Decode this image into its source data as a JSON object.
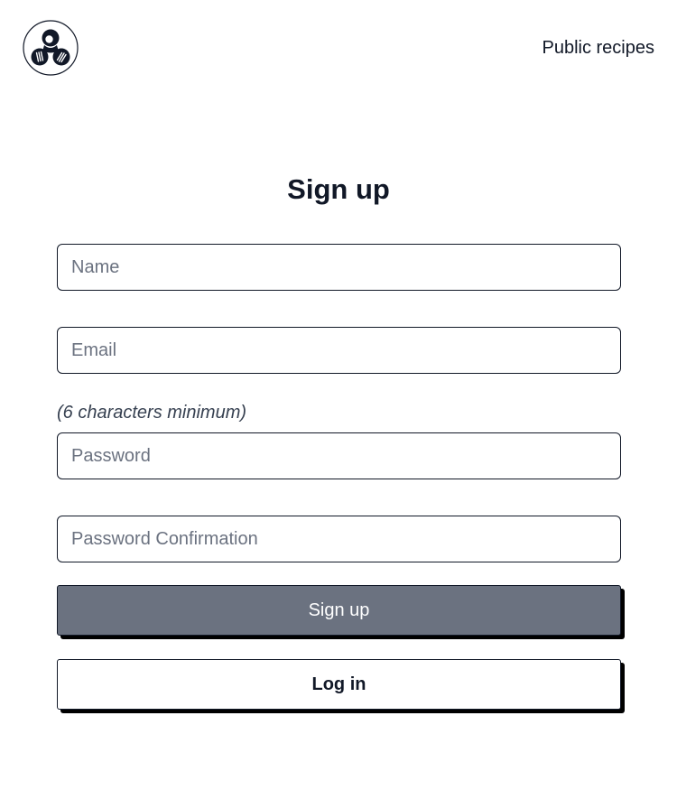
{
  "header": {
    "logo_icon": "chef-hat-cooking-logo-icon",
    "nav_link": "Public recipes"
  },
  "form": {
    "title": "Sign up",
    "name_placeholder": "Name",
    "name_value": "",
    "email_placeholder": "Email",
    "email_value": "",
    "password_hint": "(6 characters minimum)",
    "password_placeholder": "Password",
    "password_value": "",
    "password_confirmation_placeholder": "Password Confirmation",
    "password_confirmation_value": "",
    "submit_label": "Sign up",
    "login_label": "Log in"
  },
  "colors": {
    "text": "#111827",
    "placeholder": "#6b7280",
    "primary_button": "#6b7280",
    "shadow": "#000000"
  }
}
